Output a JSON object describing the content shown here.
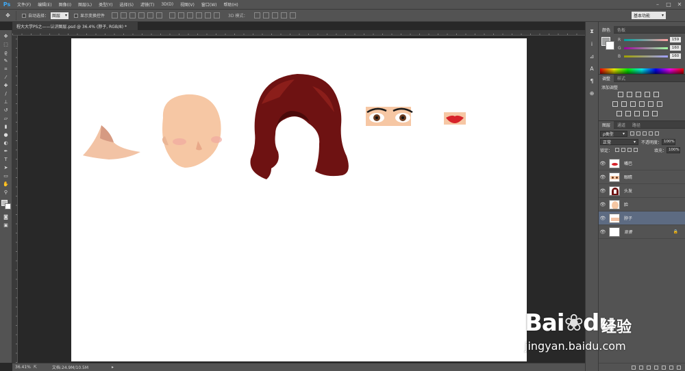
{
  "app": {
    "logo": "Ps"
  },
  "menu": [
    "文件(F)",
    "编辑(E)",
    "图像(I)",
    "图层(L)",
    "类型(Y)",
    "选择(S)",
    "滤镜(T)",
    "3D(D)",
    "视图(V)",
    "窗口(W)",
    "帮助(H)"
  ],
  "options": {
    "auto_select_label": "自动选择：",
    "auto_select_value": "图层",
    "show_transform_label": "显示变换控件",
    "mode3d_label": "3D 模式：",
    "workspace": "基本功能"
  },
  "document": {
    "tab_title": "程大大学PS之——认识图层.psd @ 36.4% (脖子, RGB/8) *"
  },
  "status": {
    "zoom": "36.41%",
    "doc_info": "文档:24.9M/10.5M"
  },
  "color_panel": {
    "tabs": [
      "颜色",
      "色板"
    ],
    "channels": [
      {
        "label": "R",
        "value": "159"
      },
      {
        "label": "G",
        "value": "160"
      },
      {
        "label": "B",
        "value": "160"
      }
    ],
    "foreground": "#9fa0a0",
    "background": "#ffffff"
  },
  "adjust_panel": {
    "tabs": [
      "调整",
      "样式"
    ],
    "title": "添加调整"
  },
  "layers_panel": {
    "tabs": [
      "图层",
      "通道",
      "路径"
    ],
    "filter": "ρ类型",
    "blend_mode": "正常",
    "opacity_label": "不透明度：",
    "opacity_value": "100%",
    "lock_label": "锁定：",
    "fill_label": "填充：",
    "fill_value": "100%",
    "layers": [
      {
        "name": "嘴巴",
        "selected": false,
        "italic": false
      },
      {
        "name": "眼睛",
        "selected": false,
        "italic": false
      },
      {
        "name": "头发",
        "selected": false,
        "italic": false
      },
      {
        "name": "脸",
        "selected": false,
        "italic": false
      },
      {
        "name": "脖子",
        "selected": true,
        "italic": false
      },
      {
        "name": "背景",
        "selected": false,
        "italic": true
      }
    ]
  },
  "watermark": {
    "logo": "Bai",
    "logo_end": "du",
    "cn": "经验",
    "url": "jingyan.baidu.com"
  }
}
